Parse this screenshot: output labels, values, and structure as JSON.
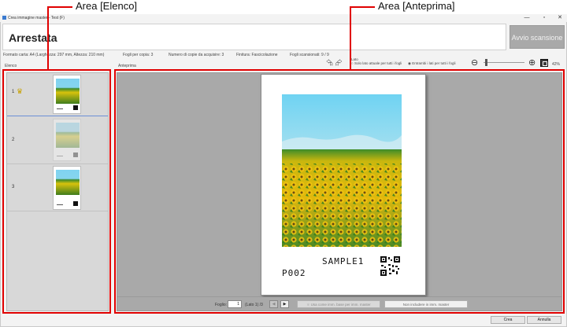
{
  "window": {
    "title": "Crea immagine master - Test (F)",
    "minimize_glyph": "—",
    "maximize_glyph": "▫",
    "close_glyph": "✕"
  },
  "banner": {
    "status_title": "Arrestata",
    "start_button": "Avvio scansione"
  },
  "info": {
    "paper_size": "Formato carta:  A4  (Larghezza: 297 mm, Altezza: 210 mm)",
    "sheets_per_copy": "Fogli per copia:  3",
    "copies": "Numero di copie da acquisire:  3",
    "finishing": "Finitura:  Fascicolazione",
    "scanned_sheets": "Fogli scansionati:   9 / 9"
  },
  "sections": {
    "list_label": "Elenco",
    "preview_label": "Anteprima",
    "rotate_icons": "⮲ ⮳",
    "radio_group_label": "Lato",
    "radio_current": "Solo lato attuale per tutti i fogli",
    "radio_both": "Entrambi i lati per tutti i fogli"
  },
  "zoom": {
    "level": "42%",
    "level_fraction": 0.05,
    "out_glyph": "⊖",
    "in_glyph": "⊕"
  },
  "list": {
    "rows": [
      {
        "number": "1",
        "selected": true,
        "master": true
      },
      {
        "number": "2",
        "selected": false,
        "master": false
      },
      {
        "number": "3",
        "selected": false,
        "master": false
      }
    ],
    "crown_glyph": "♛"
  },
  "preview": {
    "sample_label": "SAMPLE1",
    "id_label": "P002"
  },
  "footer": {
    "sheet_label": "Foglio:",
    "sheet_value": "1",
    "sheet_total": "(Lato 1) /3",
    "prev_glyph": "◀",
    "next_glyph": "▶",
    "use_as_master": "Usa come imm. base per imm. master",
    "exclude_master": "Non includere in imm. master"
  },
  "bottom": {
    "create_button": "Crea",
    "cancel_button": "Annulla"
  },
  "annotations": {
    "list_area": "Area [Elenco]",
    "preview_area": "Area [Anteprima]"
  },
  "colors": {
    "annotation_red": "#e00000",
    "panel_gray": "#a9a9a9",
    "list_gray": "#d8d8d8",
    "selection_blue": "#6b8fd6"
  }
}
